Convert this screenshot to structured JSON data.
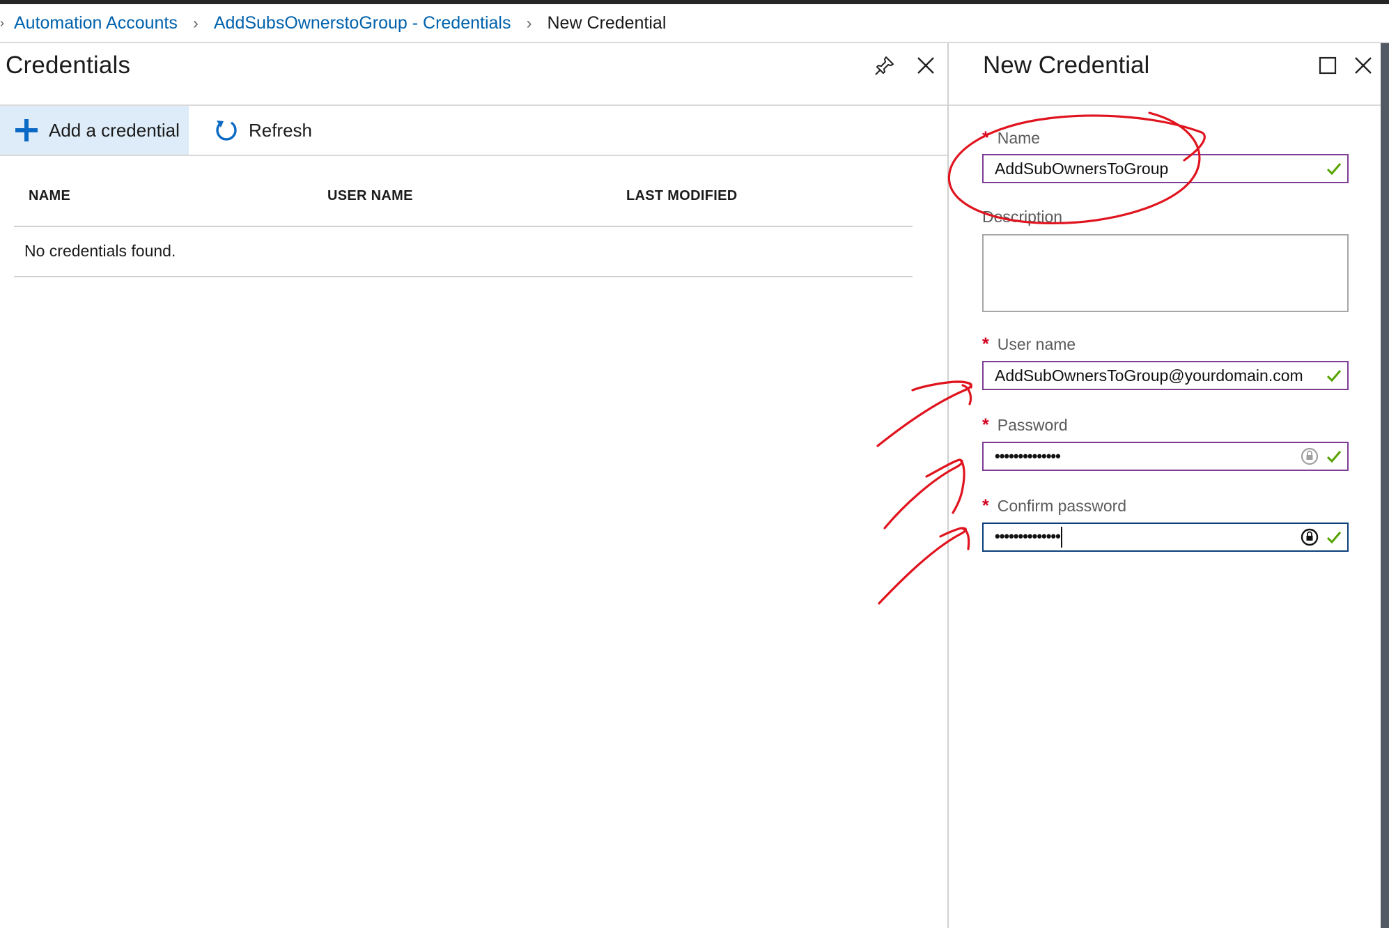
{
  "breadcrumb": {
    "items": [
      {
        "label": "Automation Accounts"
      },
      {
        "label": "AddSubsOwnerstoGroup - Credentials"
      }
    ],
    "current": "New Credential"
  },
  "credentials_blade": {
    "title": "Credentials",
    "toolbar": {
      "add_label": "Add a credential",
      "refresh_label": "Refresh"
    },
    "grid": {
      "columns": [
        "NAME",
        "USER NAME",
        "LAST MODIFIED"
      ],
      "empty_message": "No credentials found."
    },
    "icons": [
      "pin-icon",
      "close-icon"
    ]
  },
  "new_credential": {
    "title": "New Credential",
    "fields": {
      "name": {
        "label": "Name",
        "required": true,
        "value": "AddSubOwnersToGroup"
      },
      "description": {
        "label": "Description",
        "required": false,
        "value": ""
      },
      "username": {
        "label": "User name",
        "required": true,
        "value": "AddSubOwnersToGroup@yourdomain.com"
      },
      "password": {
        "label": "Password",
        "required": true,
        "value": "••••••••••••••"
      },
      "confirm_password": {
        "label": "Confirm password",
        "required": true,
        "value": "••••••••••••••"
      }
    },
    "required_marker": "*",
    "icons": [
      "maximize-icon",
      "close-icon",
      "checkmark-icon",
      "password-lock-icon"
    ]
  },
  "colors": {
    "link": "#0062ad",
    "required": "#d1001f",
    "field_border": "#7f3c95",
    "focused_border": "#0b3f79",
    "valid_check": "#57a300",
    "toolbar_highlight": "#ddecf8",
    "annotation": "#e0141e"
  }
}
